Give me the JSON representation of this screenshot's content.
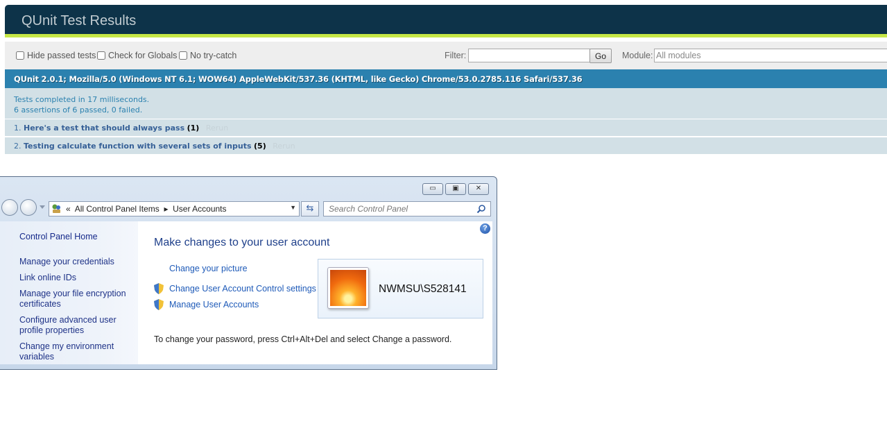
{
  "qunit": {
    "title": "QUnit Test Results",
    "toolbar": {
      "hide_passed": "Hide passed tests",
      "check_globals": "Check for Globals",
      "no_try_catch": "No try-catch",
      "filter_label": "Filter:",
      "filter_value": "",
      "go_label": "Go",
      "module_label": "Module:",
      "module_value": "All modules"
    },
    "user_agent": "QUnit 2.0.1; Mozilla/5.0 (Windows NT 6.1; WOW64) AppleWebKit/537.36 (KHTML, like Gecko) Chrome/53.0.2785.116 Safari/537.36",
    "result": {
      "line1": "Tests completed in 17 milliseconds.",
      "line2": "6 assertions of 6 passed, 0 failed."
    },
    "tests": [
      {
        "num": "1.",
        "name": "Here's a test that should always pass",
        "count": "(1)",
        "rerun": "Rerun"
      },
      {
        "num": "2.",
        "name": "Testing calculate function with several sets of inputs",
        "count": "(5)",
        "rerun": "Rerun"
      }
    ],
    "colors": {
      "header": "#0d3349",
      "accent": "#c6e746",
      "useragent": "#2b81af",
      "result_bg": "#d2e0e6"
    }
  },
  "control_panel": {
    "caption_buttons": {
      "minimize": "▭",
      "maximize": "▣",
      "close": "✕"
    },
    "address": {
      "prefix": "«",
      "crumb1": "All Control Panel Items",
      "separator": "▸",
      "crumb2": "User Accounts"
    },
    "search_placeholder": "Search Control Panel",
    "left_pane": [
      "Control Panel Home",
      "Manage your credentials",
      "Link online IDs",
      "Manage your file encryption certificates",
      "Configure advanced user profile properties",
      "Change my environment variables"
    ],
    "main": {
      "title": "Make changes to your user account",
      "links": [
        "Change your picture",
        "Change User Account Control settings",
        "Manage User Accounts"
      ],
      "account_name": "NWMSU\\S528141",
      "password_text": "To change your password, press Ctrl+Alt+Del and select Change a password."
    }
  }
}
